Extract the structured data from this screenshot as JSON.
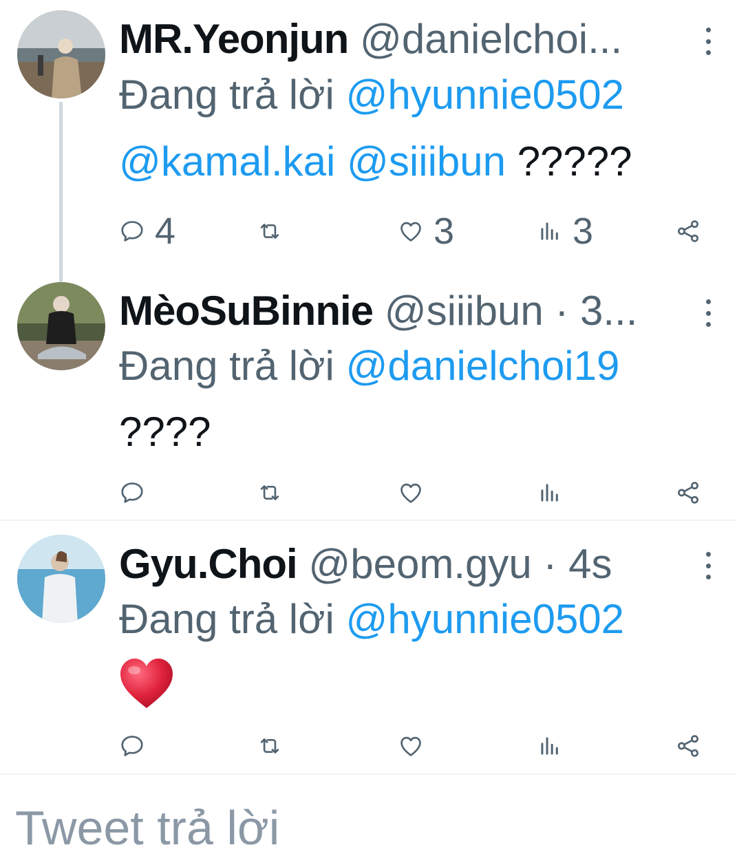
{
  "tweets": [
    {
      "name": "MR.Yeonjun",
      "handle": "@danielchoi...",
      "replying_label": "Đang trả lời",
      "replying_to": "@hyunnie0502",
      "mentions": [
        "@kamal.kai",
        "@siiibun"
      ],
      "text": "?????",
      "reply_count": "4",
      "retweet_count": "",
      "like_count": "3",
      "view_count": "3"
    },
    {
      "name": "MèoSuBinnie",
      "handle": "@siiibun · 3...",
      "replying_label": "Đang trả lời",
      "replying_to": "@danielchoi19",
      "text": "????"
    },
    {
      "name": "Gyu.Choi",
      "handle": "@beom.gyu · 4s",
      "replying_label": "Đang trả lời",
      "replying_to": "@hyunnie0502",
      "text": "❤️"
    }
  ],
  "compose": {
    "placeholder": "Tweet trả lời"
  },
  "colors": {
    "accent": "#1d9bf0",
    "muted": "#536471",
    "text": "#0f1419",
    "heart": "#e0233d"
  },
  "icons": [
    "reply-icon",
    "retweet-icon",
    "like-icon",
    "views-icon",
    "share-icon",
    "more-icon"
  ]
}
